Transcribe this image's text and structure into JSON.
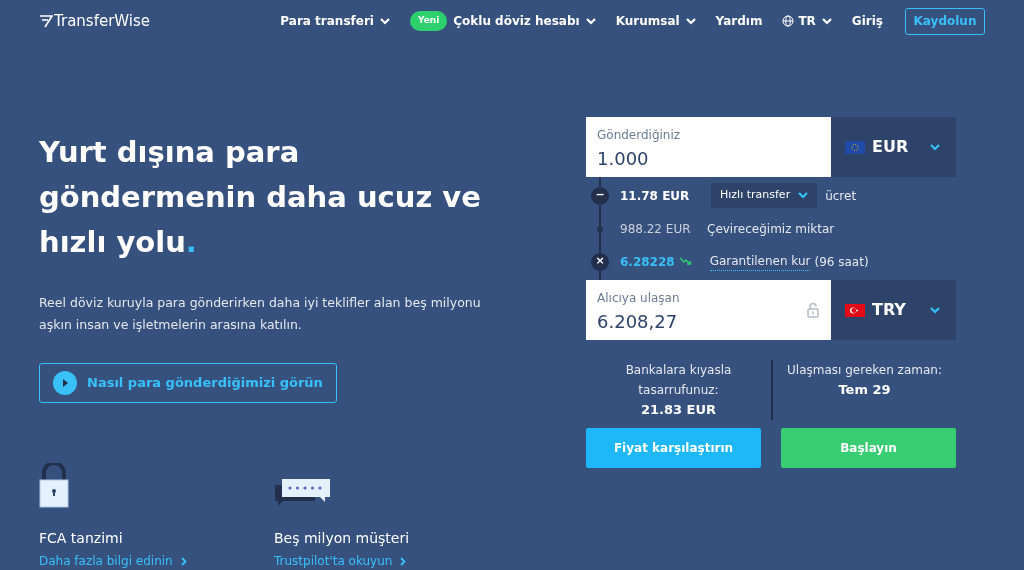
{
  "nav": {
    "logo": "TransferWise",
    "items": [
      {
        "label": "Para transferi",
        "caret": true
      },
      {
        "label": "Çoklu döviz hesabı",
        "caret": true,
        "badge": "Yeni"
      },
      {
        "label": "Kurumsal",
        "caret": true
      },
      {
        "label": "Yardım",
        "caret": false
      },
      {
        "label": "TR",
        "caret": true,
        "globe": true
      },
      {
        "label": "Giriş",
        "caret": false
      }
    ],
    "signup": "Kaydolun"
  },
  "hero": {
    "heading": "Yurt dışına para göndermenin daha ucuz ve hızlı yolu",
    "heading_accent": ".",
    "text": "Reel döviz kuruyla para gönderirken daha iyi teklifler alan beş milyonu aşkın insan ve işletmelerin arasına katılın.",
    "video_button": "Nasıl para gönderdiğimizi görün"
  },
  "features": [
    {
      "kind": "lock",
      "title": "FCA tanzimi",
      "link": "Daha fazla bilgi edinin"
    },
    {
      "kind": "reviews",
      "title": "Beş milyon müşteri",
      "link": "Trustpilot'ta okuyun"
    }
  ],
  "calculator": {
    "send": {
      "label": "Gönderdiğiniz",
      "value": "1.000",
      "currency": "EUR",
      "kind": "eu"
    },
    "fee": {
      "sign": "−",
      "amount": "11.78 EUR",
      "option": "Hızlı transfer",
      "label": "ücret"
    },
    "converted": {
      "amount": "988.22 EUR",
      "label": "Çevireceğimiz miktar"
    },
    "rate": {
      "sign": "×",
      "amount": "6.28228",
      "link": "Garantilenen kur",
      "note": "(96 saat)"
    },
    "receive": {
      "label": "Alıcıya ulaşan",
      "value": "6.208,27",
      "currency": "TRY",
      "kind": "tr",
      "locked": true
    },
    "savings": {
      "label": "Bankalara kıyasla tasarrufunuz:",
      "value": "21.83 EUR"
    },
    "arrival": {
      "label": "Ulaşması gereken zaman:",
      "value": "Tem 29"
    },
    "compare_button": "Fiyat karşılaştırın",
    "start_button": "Başlayın"
  }
}
